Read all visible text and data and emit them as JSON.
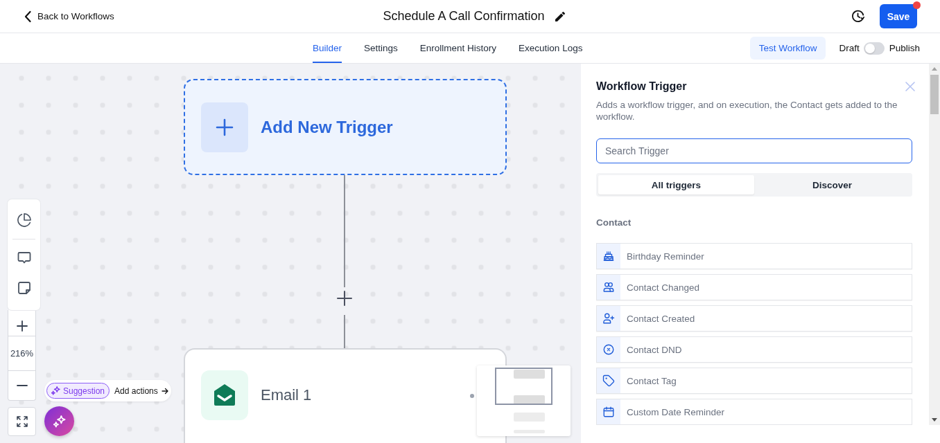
{
  "header": {
    "back_link": "Back to Workflows",
    "title": "Schedule A Call Confirmation",
    "save_button": {
      "label": "Save",
      "unsaved_dot": true
    }
  },
  "tabs": [
    {
      "label": "Builder",
      "selected": true
    },
    {
      "label": "Settings",
      "selected": false
    },
    {
      "label": "Enrollment History",
      "selected": false
    },
    {
      "label": "Execution Logs",
      "selected": false
    }
  ],
  "test_button": "Test Workflow",
  "publish_toggle": {
    "off_label": "Draft",
    "on_label": "Publish",
    "on": false
  },
  "canvas": {
    "trigger_node": {
      "label": "Add New Trigger"
    },
    "action_node": {
      "kind": "email",
      "label": "Email 1"
    },
    "zoom_level": "216%",
    "suggestion": {
      "chip": "Suggestion",
      "link": "Add actions"
    }
  },
  "trigger_panel": {
    "title": "Workflow Trigger",
    "description": "Adds a workflow trigger, and on execution, the Contact gets added to the workflow.",
    "search": {
      "placeholder": "Search Trigger",
      "focused": true
    },
    "segments": [
      {
        "label": "All triggers",
        "selected": true
      },
      {
        "label": "Discover",
        "selected": false
      }
    ],
    "section": "Contact",
    "items": [
      {
        "kind": "birthday",
        "label": "Birthday Reminder"
      },
      {
        "kind": "changed",
        "label": "Contact Changed"
      },
      {
        "kind": "created",
        "label": "Contact Created"
      },
      {
        "kind": "dnd",
        "label": "Contact DND"
      },
      {
        "kind": "tag",
        "label": "Contact Tag"
      },
      {
        "kind": "date",
        "label": "Custom Date Reminder"
      }
    ]
  }
}
